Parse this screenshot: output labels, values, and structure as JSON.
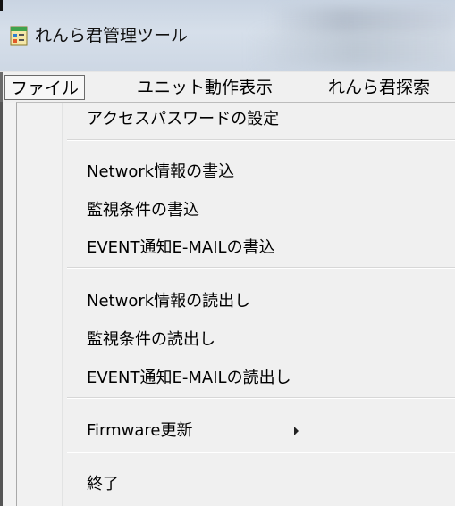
{
  "window": {
    "title": "れんら君管理ツール",
    "icon": "app-window-icon"
  },
  "menubar": {
    "items": [
      {
        "label": "ファイル",
        "active": true
      },
      {
        "label": "ユニット動作表示",
        "active": false
      },
      {
        "label": "れんら君探索",
        "active": false
      }
    ]
  },
  "file_menu": {
    "groups": [
      {
        "items": [
          {
            "label": "アクセスパスワードの設定"
          }
        ]
      },
      {
        "items": [
          {
            "label": "Network情報の書込"
          },
          {
            "label": "監視条件の書込"
          },
          {
            "label": "EVENT通知E-MAILの書込"
          }
        ]
      },
      {
        "items": [
          {
            "label": "Network情報の読出し"
          },
          {
            "label": "監視条件の読出し"
          },
          {
            "label": "EVENT通知E-MAILの読出し"
          }
        ]
      },
      {
        "items": [
          {
            "label": "Firmware更新",
            "submenu": true,
            "submenu_icon": "chevron-right-icon"
          }
        ]
      },
      {
        "items": [
          {
            "label": "終了"
          }
        ]
      }
    ]
  }
}
